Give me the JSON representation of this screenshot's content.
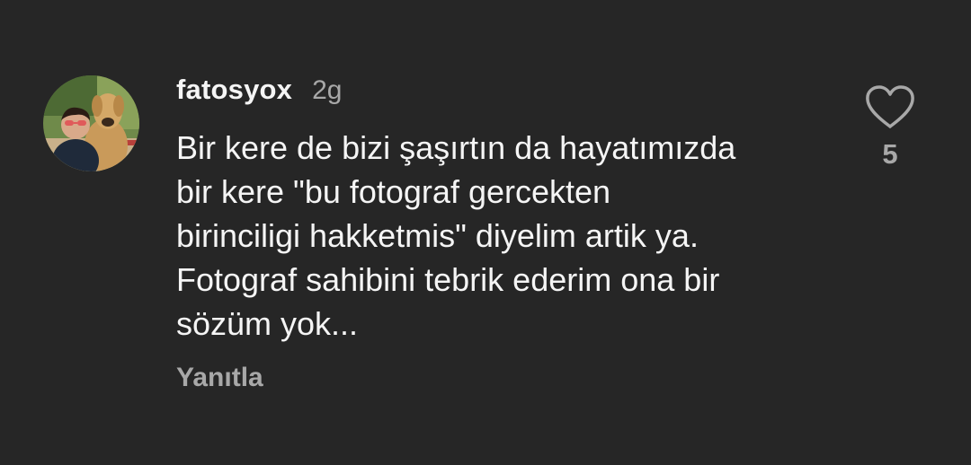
{
  "comment": {
    "username": "fatosyox",
    "time_ago": "2g",
    "text": "Bir kere de bizi şaşırtın da hayatımızda\nbir kere \"bu fotograf gercekten\nbirinciligi hakketmis\" diyelim artik ya.\nFotograf sahibini tebrik ederim ona bir\nsözüm yok...",
    "reply_label": "Yanıtla",
    "like_count": "5",
    "like_icon": "heart-outline-icon"
  },
  "colors": {
    "background": "#262626",
    "primary_text": "#f5f5f5",
    "secondary_text": "#a8a8a8"
  }
}
